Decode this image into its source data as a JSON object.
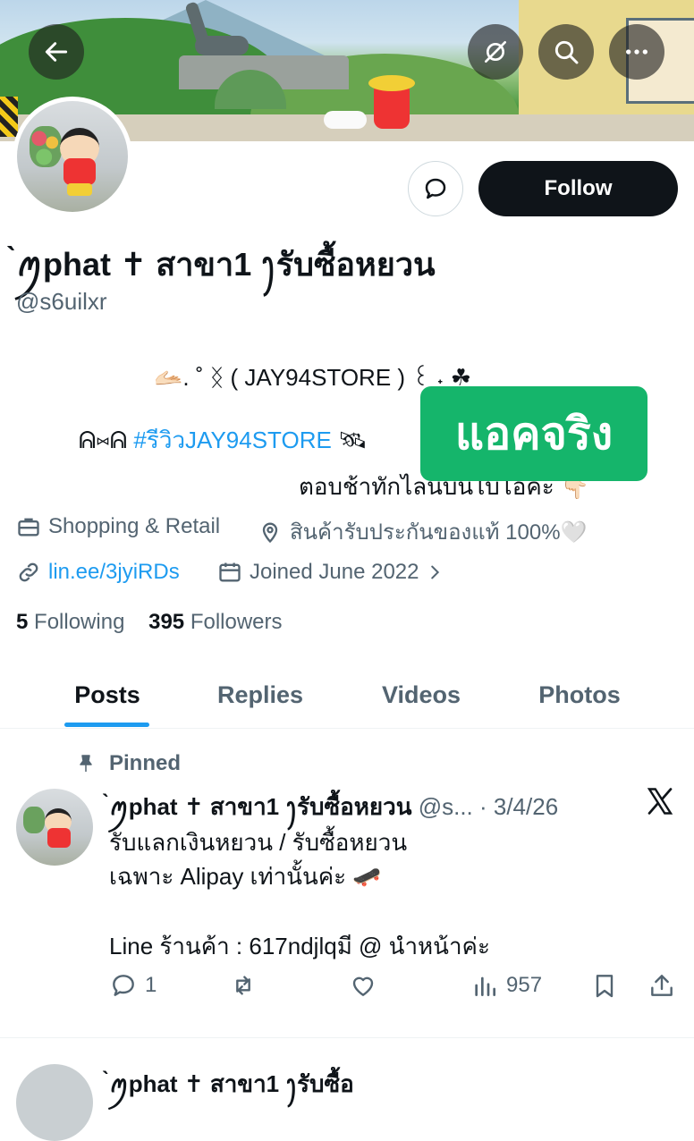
{
  "header": {
    "back_icon": "arrow-left-icon",
    "notif_icon": "bell-off-icon",
    "search_icon": "search-icon",
    "more_icon": "ellipsis-icon"
  },
  "profile": {
    "display_name": "̀ꪑphat ✝︎ สาขา1 ꫂรับซื้อหยวน",
    "handle": "@s6uilxr",
    "follow_label": "Follow",
    "bio": {
      "line1": "🫴🏻. ˚ ᛝ ( JAY94STORE )   ꒰ ˖ ☘",
      "line2_prefix": "ᕱ⑅ᕱ ",
      "line2_tag": "#รีวิวJAY94STORE",
      "line2_suffix": " 🛰",
      "line3": "ตอบช้าทักไลน์บนไบโอค่ะ 👇🏻"
    },
    "sticker_text": "แอคจริง",
    "category": "Shopping & Retail",
    "location": "สินค้ารับประกันของแท้ 100%🤍",
    "link": "lin.ee/3jyiRDs",
    "joined": "Joined June 2022",
    "following_count": "5",
    "following_label": "Following",
    "followers_count": "395",
    "followers_label": "Followers"
  },
  "tabs": [
    {
      "label": "Posts",
      "active": true
    },
    {
      "label": "Replies",
      "active": false
    },
    {
      "label": "Videos",
      "active": false
    },
    {
      "label": "Photos",
      "active": false
    }
  ],
  "pinned_post": {
    "pinned_label": "Pinned",
    "author": "̀ꪑphat ✝︎ สาขา1 ꫂรับซื้อหยวน",
    "handle_date": " @s... · 3/4/26",
    "lines": [
      "รับแลกเงินหยวน / รับซื้อหยวน",
      "เฉพาะ Alipay เท่านั้นค่ะ 🛹",
      "Line ร้านค้า : 617ndjlqมี @ นำหน้าค่ะ"
    ],
    "reply_count": "1",
    "views": "957"
  },
  "next_post": {
    "author_partial": "̀ꪑphat ✝︎ สาขา1 ꫂรับซื้อ"
  }
}
